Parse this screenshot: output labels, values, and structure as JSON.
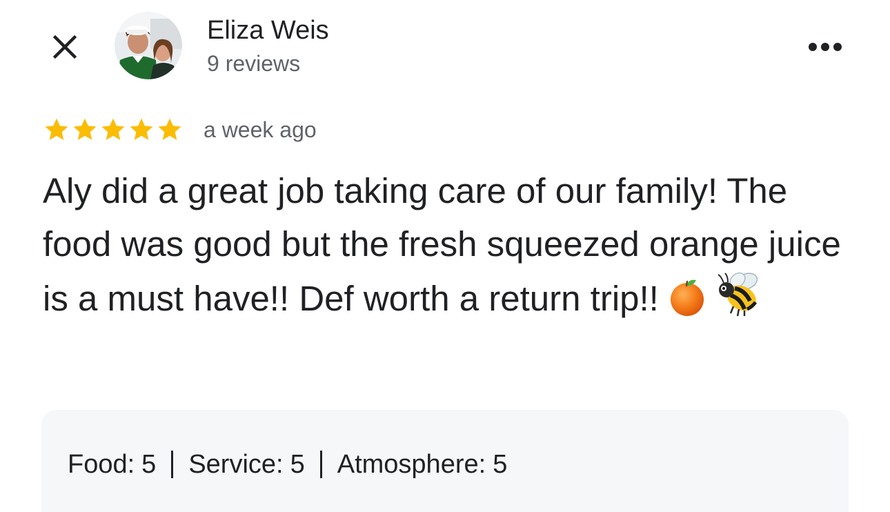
{
  "header": {
    "reviewer_name": "Eliza Weis",
    "review_count": "9 reviews",
    "close_icon": "close-icon",
    "more_icon": "more-horizontal-icon"
  },
  "review": {
    "rating": 5,
    "max_rating": 5,
    "star_color": "#fbbc04",
    "time_ago": "a week ago",
    "text": "Aly did a great job taking care of our family! The food was good but the fresh squeezed orange juice is a must have!! Def worth a return trip!!",
    "emojis": [
      "orange-emoji",
      "bee-emoji"
    ]
  },
  "ratings": [
    {
      "label": "Food:",
      "value": "5"
    },
    {
      "label": "Service:",
      "value": "5"
    },
    {
      "label": "Atmosphere:",
      "value": "5"
    }
  ]
}
